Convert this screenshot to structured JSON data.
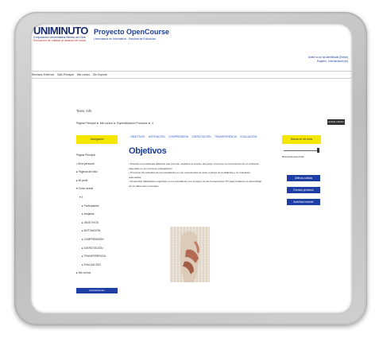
{
  "header": {
    "logo": "UNIMINUTO",
    "logo_line1": "Corporación Universitaria Minuto de Dios",
    "logo_line2": "Educación de calidad al alcance de todos",
    "course_title": "Proyecto OpenCourse",
    "course_subtitle": "Licenciatura en Informática - Facultad de Educación",
    "top_link": "Usted no se ha identificado (Entrar)",
    "top_link2": "Español - Internacional (es)"
  },
  "menubar": [
    "Servicios Externos",
    "Salir Principal",
    "Mis cursos",
    "Sin Soporte"
  ],
  "page": {
    "texto": "Texto: Info",
    "breadcrumb": "Página Principal ► Mis cursos ► Especialización Procesos ► 4",
    "nav_button": "Activar edición"
  },
  "navigation": {
    "title": "Navegación",
    "items": [
      "Página Principal",
      "• Área personal",
      "▸ Páginas del sitio",
      "▸ Mi perfil",
      "▾ Curso actual",
      "▾ 4",
      "▸ Participantes",
      "▸ Insignias",
      "▸ OBJETIVOS",
      "▸ MOTIVACIÓN",
      "▸ COMPRENSIÓN",
      "▸ EJERCITACIÓN",
      "▸ TRANSFERENCIA",
      "▸ EVALUACIÓN",
      "▸ Mis cursos"
    ],
    "footer": "Administración"
  },
  "tabs": [
    "OBJETIVOS",
    "MOTIVACIÓN",
    "COMPRENSIÓN",
    "EJERCITACIÓN",
    "TRANSFERENCIA",
    "EVALUACIÓN"
  ],
  "content": {
    "title": "Objetivos",
    "bullets": [
      "• Diseñar una estrategia didáctica que permita, mediante el empleo del juego, promover la construcción de un ambiente",
      "  adecuado en los procesos pedagógicos.",
      "• Promover las actitudes de los estudiantes en sus experiencias de aula, a través de la didáctica y la motivación",
      "  adecuadas.",
      "• Desarrollar habilidades cognitivas en los estudiantes con el apoyo de las herramientas TIC para fortalecer el aprendizaje",
      "  de los diferentes conceptos."
    ]
  },
  "right_column": {
    "header": "Buscar en los foros",
    "slider_label": "Búsqueda avanzada",
    "buttons": [
      "Últimas noticias",
      "Eventos próximos",
      "Actividad reciente"
    ]
  },
  "colors": {
    "accent_yellow": "#f5e600",
    "brand_blue": "#1e3fa6",
    "title_blue": "#1a3d99"
  }
}
